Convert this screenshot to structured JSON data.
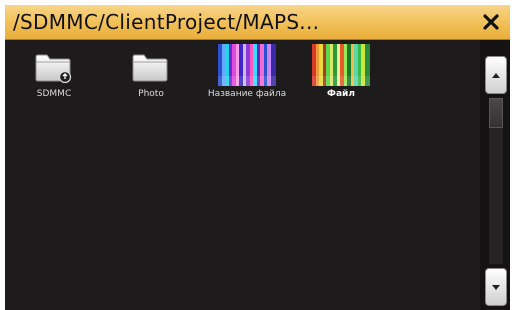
{
  "window": {
    "title": "/SDMMC/ClientProject/MAPS...",
    "close_icon": "close-icon"
  },
  "items": [
    {
      "label": "SDMMC",
      "icon": "folder-icon-with-badge",
      "bold": false
    },
    {
      "label": "Photo",
      "icon": "folder-icon",
      "bold": false
    },
    {
      "label": "Название файла",
      "icon": "rainbow-image-thumbnail",
      "bold": false
    },
    {
      "label": "Файл",
      "icon": "rainbow-image-thumbnail",
      "bold": true
    }
  ],
  "scrollbar": {
    "up_icon": "arrow-up-icon",
    "down_icon": "arrow-down-icon",
    "position_fraction": 0.0
  },
  "colors": {
    "titlebar": "#f2c35e",
    "background": "#1d1b1b",
    "label_text": "#dcdcdc"
  }
}
